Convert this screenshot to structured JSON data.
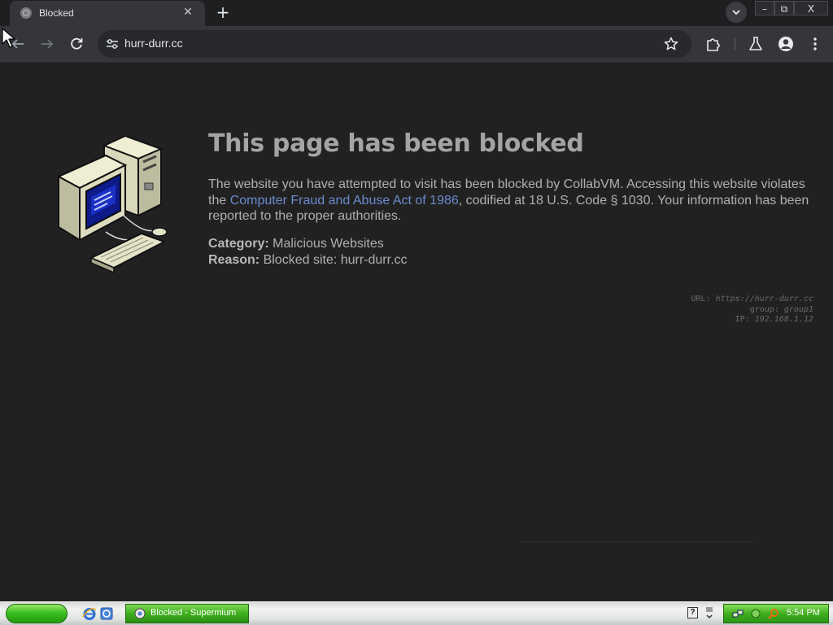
{
  "browser": {
    "tab_title": "Blocked",
    "url": "hurr-durr.cc",
    "window_controls": {
      "minimize": "–",
      "restore": "⧉",
      "close": "X"
    },
    "icons": [
      "globe-icon",
      "close-icon",
      "plus-icon",
      "chevron-down-icon",
      "back-arrow-icon",
      "forward-arrow-icon",
      "reload-icon",
      "site-settings-icon",
      "star-icon",
      "extensions-icon",
      "labs-flask-icon",
      "profile-icon",
      "kebab-menu-icon"
    ]
  },
  "page": {
    "heading": "This page has been blocked",
    "desc_part1": "The website you have attempted to visit has been blocked by CollabVM. Accessing this website violates the ",
    "desc_link": "Computer Fraud and Abuse Act of 1986",
    "desc_part2": ", codified at 18 U.S. Code § 1030. Your information has been reported to the proper authorities.",
    "category_label": "Category:",
    "category_value": " Malicious Websites",
    "reason_label": "Reason:",
    "reason_value": " Blocked site: hurr-durr.cc",
    "debug": {
      "url_key": "URL:",
      "url_value": "https://hurr-durr.cc",
      "group_key": "group:",
      "group_value": "group1",
      "ip_key": "IP:",
      "ip_value": "192.168.1.12"
    },
    "link_color": "#6b8cd0"
  },
  "taskbar": {
    "task_label": "Blocked - Supermium",
    "help_glyph": "?",
    "clock": "5:54 PM",
    "start_color": "#3cbf1f"
  }
}
